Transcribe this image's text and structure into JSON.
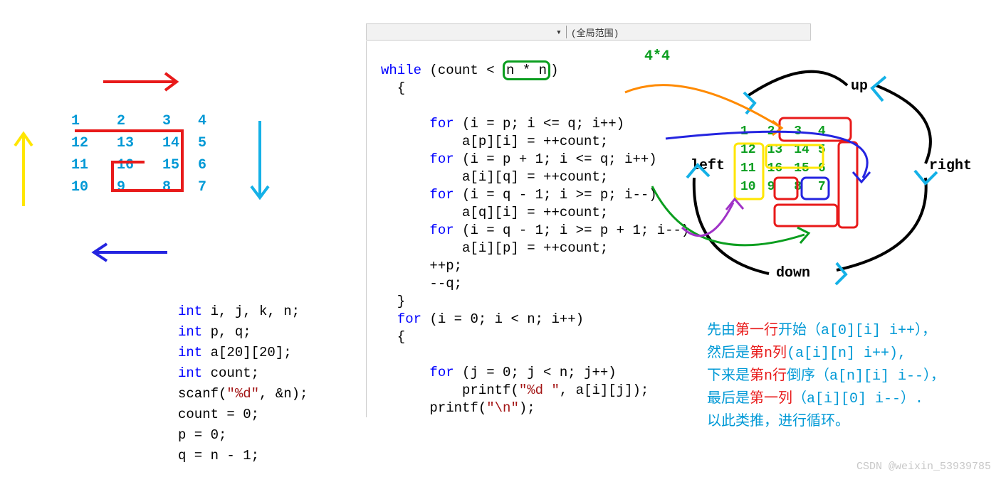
{
  "editor_scope_label": "(全局范围)",
  "left_spiral": {
    "rows": [
      [
        "1",
        "2",
        "3",
        "4"
      ],
      [
        "12",
        "13",
        "14",
        "5"
      ],
      [
        "11",
        "16",
        "15",
        "6"
      ],
      [
        "10",
        "9",
        "8",
        "7"
      ]
    ]
  },
  "annotation_4x4": "4*4",
  "direction_labels": {
    "up": "up",
    "down": "down",
    "left": "left",
    "right": "right"
  },
  "code_left": {
    "l1_kw": "int",
    "l1_rest": " i, j, k, n;",
    "l2_kw": "int",
    "l2_rest": " p, q;",
    "l3_kw": "int",
    "l3_rest": " a[20][20];",
    "l4_kw": "int",
    "l4_rest": " count;",
    "l5_id": "scanf(",
    "l5_str": "\"%d\"",
    "l5_rest": ", &n);",
    "l6": "count = 0;",
    "l7": "p = 0;",
    "l8": "q = n - 1;"
  },
  "code_main": {
    "a1_kw": "while",
    "a1_mid": " (count < ",
    "a1_box": "n * n",
    "a1_close": ")",
    "a2": "  {",
    "b1_kw": "for",
    "b1": " (i = p; i <= q; i++)",
    "b2": "          a[p][i] = ++count;",
    "c1_kw": "for",
    "c1": " (i = p + 1; i <= q; i++)",
    "c2": "          a[i][q] = ++count;",
    "d1_kw": "for",
    "d1": " (i = q - 1; i >= p; i--)",
    "d2": "          a[q][i] = ++count;",
    "e1_kw": "for",
    "e1": " (i = q - 1; i >= p + 1; i--)",
    "e2": "          a[i][p] = ++count;",
    "f1": "      ++p;",
    "f2": "      --q;",
    "f3": "  }",
    "g1_kw": "for",
    "g1": " (i = 0; i < n; i++)",
    "g2": "  {",
    "h1_kw": "for",
    "h1": " (j = 0; j < n; j++)",
    "h2a": "          printf(",
    "h2str": "\"%d \"",
    "h2b": ", a[i][j]);",
    "i1a": "      printf(",
    "i1str": "\"\\n\"",
    "i1b": ");"
  },
  "right_spiral": {
    "rows": [
      [
        "1",
        "2",
        "3",
        "4"
      ],
      [
        "12",
        "13",
        "14",
        "5"
      ],
      [
        "11",
        "16",
        "15",
        "6"
      ],
      [
        "10",
        "9",
        "8",
        "7"
      ]
    ]
  },
  "explanation": {
    "l1a": "先由",
    "l1b": "第一行",
    "l1c": "开始（a[0][i] i++），",
    "l2a": "然后是",
    "l2b": "第n列",
    "l2c": "(a[i][n] i++),",
    "l3a": "下来是",
    "l3b": "第n行",
    "l3c": "倒序（a[n][i] i--），",
    "l4a": "最后是",
    "l4b": "第一列",
    "l4c": "（a[i][0] i--）.",
    "l5": "以此类推，进行循环。"
  },
  "watermark": "CSDN @weixin_53939785"
}
